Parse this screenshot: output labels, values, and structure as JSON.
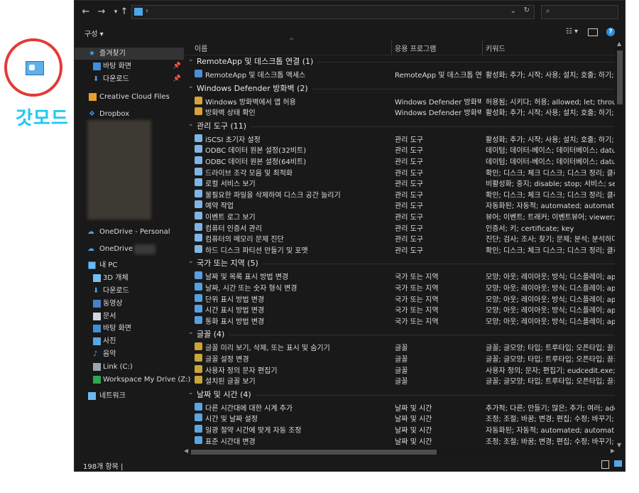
{
  "overlay": {
    "label": "갓모드"
  },
  "addressbar": {
    "separator": "›"
  },
  "toolbar": {
    "organize": "구성 ▾",
    "help": "?"
  },
  "sidebar": {
    "quick_access": "즐겨찾기",
    "pinned": [
      {
        "label": "바탕 화면"
      },
      {
        "label": "다운로드"
      }
    ],
    "creative_cloud": "Creative Cloud Files",
    "dropbox": "Dropbox",
    "onedrive_personal": "OneDrive - Personal",
    "onedrive_other": "OneDrive -",
    "this_pc": "내 PC",
    "pc_items": [
      {
        "label": "3D 개체"
      },
      {
        "label": "다운로드"
      },
      {
        "label": "동영상"
      },
      {
        "label": "문서"
      },
      {
        "label": "바탕 화면"
      },
      {
        "label": "사진"
      },
      {
        "label": "음악"
      },
      {
        "label": "Link (C:)"
      },
      {
        "label": "Workspace My Drive (Z:)"
      }
    ],
    "network": "네트워크"
  },
  "columns": {
    "name": "이름",
    "app": "응용 프로그램",
    "keywords": "키워드"
  },
  "groups": [
    {
      "title": "RemoteApp 및 데스크톱 연결 (1)",
      "items": [
        {
          "name": "RemoteApp 및 데스크톱 액세스",
          "app": "RemoteApp 및 데스크톱 연결",
          "kw": "활성화; 추가; 시작; 사용; 설치; 호출; 하기; 설"
        }
      ]
    },
    {
      "title": "Windows Defender 방화벽 (2)",
      "items": [
        {
          "name": "Windows 방화벽에서 앱 허용",
          "app": "Windows Defender 방화벽",
          "kw": "허용됨; 시키다; 허용; allowed; let; through; pe"
        },
        {
          "name": "방화벽 상태 확인",
          "app": "Windows Defender 방화벽",
          "kw": "활성화; 추가; 시작; 사용; 설치; 호출; 하기; 설"
        }
      ]
    },
    {
      "title": "관리 도구 (11)",
      "items": [
        {
          "name": "iSCSI 초기자 설정",
          "app": "관리 도구",
          "kw": "활성화; 추가; 시작; 사용; 설치; 호출; 하기; 설"
        },
        {
          "name": "ODBC 데이터 원본 설정(32비트)",
          "app": "관리 도구",
          "kw": "데이텀; 데이터-베이스; 데이터베이스; datum;"
        },
        {
          "name": "ODBC 데이터 원본 설정(64비트)",
          "app": "관리 도구",
          "kw": "데이텀; 데이터-베이스; 데이터베이스; datum;"
        },
        {
          "name": "드라이브 조각 모음 및 최적화",
          "app": "관리 도구",
          "kw": "확인; 디스크; 체크 디스크; 디스크 정리; 클리너"
        },
        {
          "name": "로컬 서비스 보기",
          "app": "관리 도구",
          "kw": "비활성화; 중지; disable; stop; 서비스; services;"
        },
        {
          "name": "불필요한 파일을 삭제하여 디스크 공간 늘리기",
          "app": "관리 도구",
          "kw": "확인; 디스크; 체크 디스크; 디스크 정리; 클리너"
        },
        {
          "name": "예약 작업",
          "app": "관리 도구",
          "kw": "자동화된; 자동적; automated; automatically; C"
        },
        {
          "name": "이벤트 로그 보기",
          "app": "관리 도구",
          "kw": "뷰어; 이벤트; 트래커; 이벤트뷰어; viewer; ever"
        },
        {
          "name": "컴퓨터 인증서 관리",
          "app": "관리 도구",
          "kw": "인증서; 키; certificate; key"
        },
        {
          "name": "컴퓨터의 메모리 문제 진단",
          "app": "관리 도구",
          "kw": "진단; 검사; 조사; 찾기; 문제; 분석; 분석하다; 3"
        },
        {
          "name": "하드 디스크 파티션 만들기 및 포맷",
          "app": "관리 도구",
          "kw": "확인; 디스크; 체크 디스크; 디스크 정리; 클리너"
        }
      ]
    },
    {
      "title": "국가 또는 지역 (5)",
      "items": [
        {
          "name": "날짜 및 목록 표시 방법 변경",
          "app": "국가 또는 지역",
          "kw": "모양; 아웃; 레이아웃; 방식; 디스플레이; appea"
        },
        {
          "name": "날짜, 시간 또는 숫자 형식 변경",
          "app": "국가 또는 지역",
          "kw": "모양; 아웃; 레이아웃; 방식; 디스플레이; appea"
        },
        {
          "name": "단위 표시 방법 변경",
          "app": "국가 또는 지역",
          "kw": "모양; 아웃; 레이아웃; 방식; 디스플레이; appea"
        },
        {
          "name": "시간 표시 방법 변경",
          "app": "국가 또는 지역",
          "kw": "모양; 아웃; 레이아웃; 방식; 디스플레이; appea"
        },
        {
          "name": "통화 표시 방법 변경",
          "app": "국가 또는 지역",
          "kw": "모양; 아웃; 레이아웃; 방식; 디스플레이; appea"
        }
      ]
    },
    {
      "title": "글꼴 (4)",
      "items": [
        {
          "name": "글꼴 미리 보기, 삭제, 또는 표시 및 숨기기",
          "app": "글꼴",
          "kw": "글꼴; 글모양; 타입; 트루타입; 오픈타입; 끌꼴;"
        },
        {
          "name": "글꼴 설정 변경",
          "app": "글꼴",
          "kw": "글꼴; 글모양; 타입; 트루타입; 오픈타입; 끌꼴;"
        },
        {
          "name": "사용자 정의 문자 편집기",
          "app": "글꼴",
          "kw": "사용자 정의; 문자; 편집기; eudcedit.exe; priva"
        },
        {
          "name": "설치된 글꼴 보기",
          "app": "글꼴",
          "kw": "글꼴; 글모양; 타입; 트루타입; 오픈타입; 끌꼴;"
        }
      ]
    },
    {
      "title": "날짜 및 시간 (4)",
      "items": [
        {
          "name": "다른 시간대에 대한 시계 추가",
          "app": "날짜 및 시간",
          "kw": "추가적; 다른; 만들기; 많은; 추가; 여러; additio"
        },
        {
          "name": "시간 및 날짜 설정",
          "app": "날짜 및 시간",
          "kw": "조정; 조절; 바꿈; 변경; 편집; 수정; 바꾸기; 다시"
        },
        {
          "name": "일광 절약 시간에 맞게 자동 조정",
          "app": "날짜 및 시간",
          "kw": "자동화된; 자동적; automated; automatically; 3"
        },
        {
          "name": "표준 시간대 변경",
          "app": "날짜 및 시간",
          "kw": "조정; 조절; 바꿈; 변경; 편집; 수정; 바꾸기; 다시"
        }
      ]
    }
  ],
  "status": {
    "count": "198개 항목  |"
  },
  "colors": {
    "window_bg": "#191919",
    "accent": "#2a8fe0",
    "overlay_circle": "#e53935",
    "overlay_text": "#1ec8f0"
  }
}
